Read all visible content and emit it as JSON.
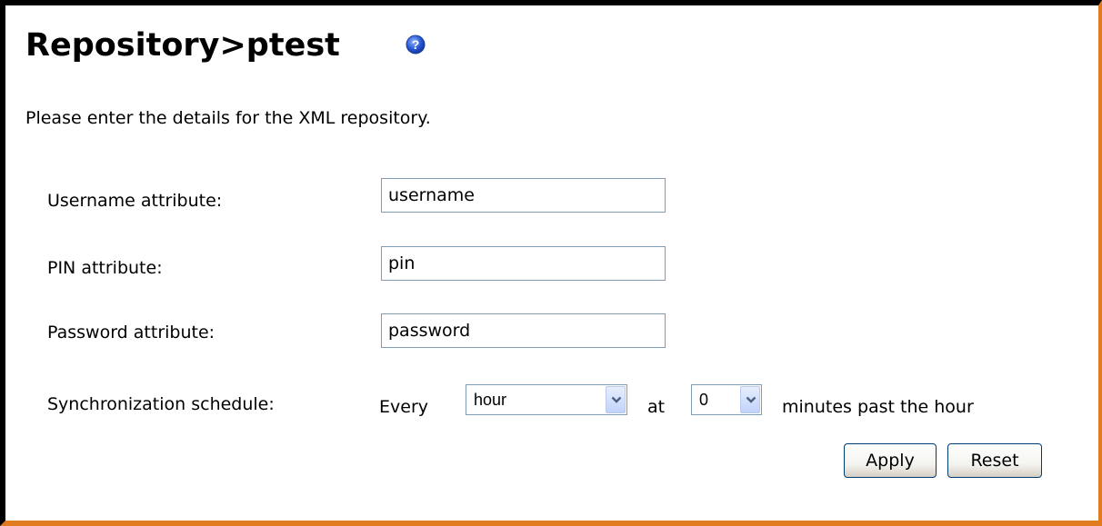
{
  "page": {
    "title": "Repository>ptest",
    "help_icon": "help-icon",
    "intro": "Please enter the details for the XML repository."
  },
  "form": {
    "username": {
      "label": "Username attribute:",
      "value": "username"
    },
    "pin": {
      "label": "PIN attribute:",
      "value": "pin"
    },
    "password": {
      "label": "Password attribute:",
      "value": "password"
    },
    "schedule": {
      "label": "Synchronization schedule:",
      "every_text": "Every",
      "interval_value": "hour",
      "at_text": "at",
      "minute_value": "0",
      "suffix_text": "minutes past the hour"
    }
  },
  "buttons": {
    "apply": "Apply",
    "reset": "Reset"
  },
  "colors": {
    "frame_left_top": "#000000",
    "frame_right_bottom": "#e07b1f",
    "input_border": "#7f9db9",
    "button_border": "#003c74",
    "help_icon": "#2a5bd7"
  }
}
